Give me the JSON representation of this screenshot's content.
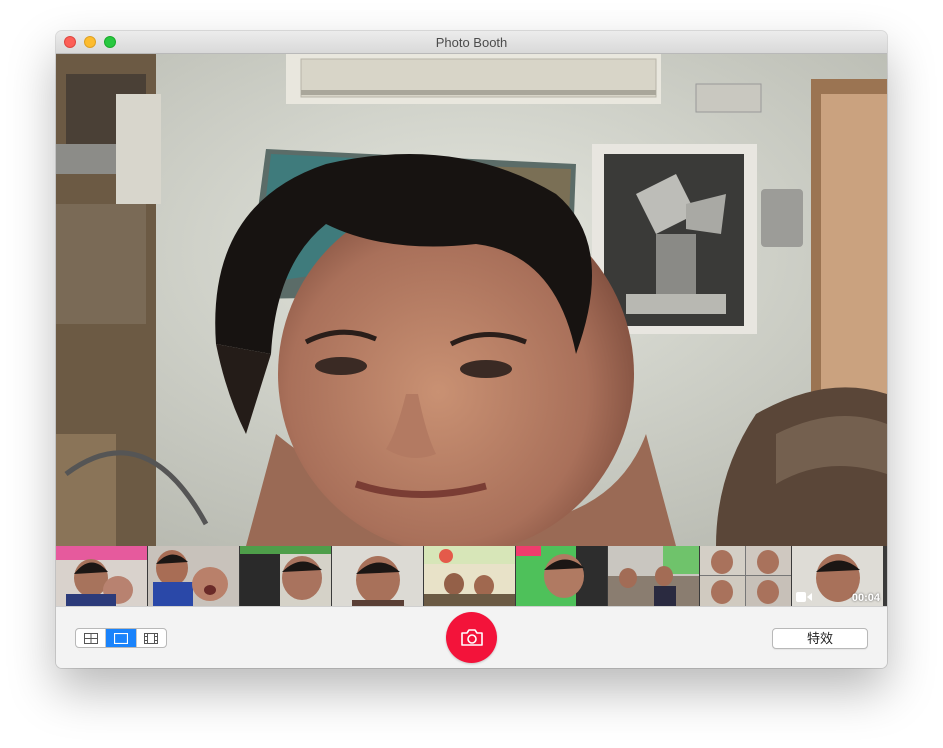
{
  "window": {
    "title": "Photo Booth"
  },
  "camera": {
    "description_icon": "live-camera-preview"
  },
  "strip": {
    "thumbnails": [
      {
        "kind": "photo"
      },
      {
        "kind": "photo"
      },
      {
        "kind": "photo"
      },
      {
        "kind": "photo"
      },
      {
        "kind": "photo"
      },
      {
        "kind": "photo"
      },
      {
        "kind": "photo"
      },
      {
        "kind": "four-up"
      },
      {
        "kind": "video",
        "duration": "00:04"
      }
    ]
  },
  "toolbar": {
    "view_modes": [
      {
        "icon": "grid-icon",
        "active": false
      },
      {
        "icon": "single-photo-icon",
        "active": true
      },
      {
        "icon": "film-strip-icon",
        "active": false
      }
    ],
    "shutter_icon": "camera-icon",
    "effects_label": "特效"
  },
  "colors": {
    "accent": "#1a83fb",
    "shutter": "#f3133a"
  }
}
